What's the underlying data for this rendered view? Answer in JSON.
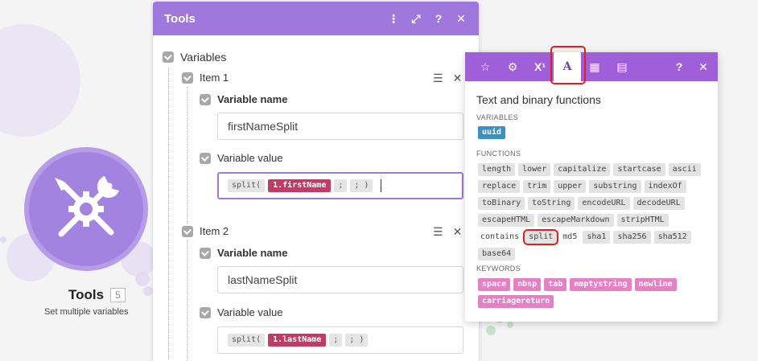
{
  "module": {
    "title": "Tools",
    "count": "5",
    "subtitle": "Set multiple variables"
  },
  "panel": {
    "title": "Tools",
    "section_label": "Variables",
    "items": [
      {
        "label": "Item 1",
        "name_label": "Variable name",
        "name_value": "firstNameSplit",
        "value_label": "Variable value",
        "fn_open": "split(",
        "var_chip": "1.firstName",
        "sep": ";",
        "fn_close": ";  )"
      },
      {
        "label": "Item 2",
        "name_label": "Variable name",
        "name_value": "lastNameSplit",
        "value_label": "Variable value",
        "fn_open": "split(",
        "var_chip": "1.lastName",
        "sep": ";",
        "fn_close": ";  )"
      }
    ]
  },
  "popup": {
    "active_tab": "A",
    "title": "Text and binary functions",
    "variables_label": "VARIABLES",
    "variables": [
      "uuid"
    ],
    "functions_label": "FUNCTIONS",
    "functions": [
      "length",
      "lower",
      "capitalize",
      "startcase",
      "ascii",
      "replace",
      "trim",
      "upper",
      "substring",
      "indexOf",
      "toBinary",
      "toString",
      "encodeURL",
      "decodeURL",
      "escapeHTML",
      "escapeMarkdown",
      "stripHTML",
      "contains",
      "split",
      "md5",
      "sha1",
      "sha256",
      "sha512",
      "base64"
    ],
    "keywords_label": "KEYWORDS",
    "keywords": [
      "space",
      "nbsp",
      "tab",
      "emptystring",
      "newline",
      "carriagereturn"
    ]
  }
}
